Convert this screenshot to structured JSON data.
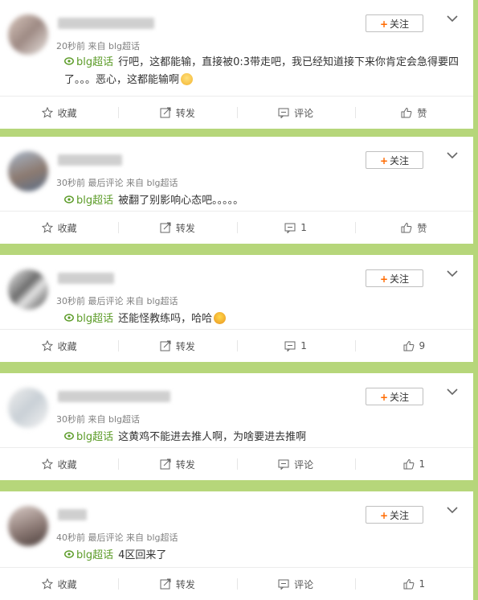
{
  "common": {
    "follow_plus": "+",
    "follow_label": "关注",
    "topic_label": "blg超话",
    "collect_label": "收藏",
    "repost_label": "转发"
  },
  "posts": [
    {
      "meta": "20秒前 来自 blg超话",
      "text": "行吧，这都能输，直接被0:3带走吧，我已经知道接下来你肯定会急得要四了。。。恶心，这都能输啊",
      "emoji": "crying-emoji",
      "comment_label": "评论",
      "like_label": "赞"
    },
    {
      "meta": "30秒前 最后评论 来自 blg超话",
      "text": "被翻了别影响心态吧。。。。。",
      "comment_label": "1",
      "like_label": "赞"
    },
    {
      "meta": "30秒前 最后评论 来自 blg超话",
      "text": "还能怪教练吗，哈哈",
      "emoji": "laughing-emoji",
      "comment_label": "1",
      "like_label": "9"
    },
    {
      "meta": "30秒前 来自 blg超话",
      "text": "这黄鸡不能进去推人啊，为啥要进去推啊",
      "comment_label": "评论",
      "like_label": "1"
    },
    {
      "meta": "40秒前 最后评论 来自 blg超话",
      "text": "4区回来了",
      "comment_label": "评论",
      "like_label": "1"
    }
  ],
  "colors": {
    "background": "#b6d67a",
    "topic": "#5b9b27",
    "follow_plus": "#ff6a00"
  }
}
